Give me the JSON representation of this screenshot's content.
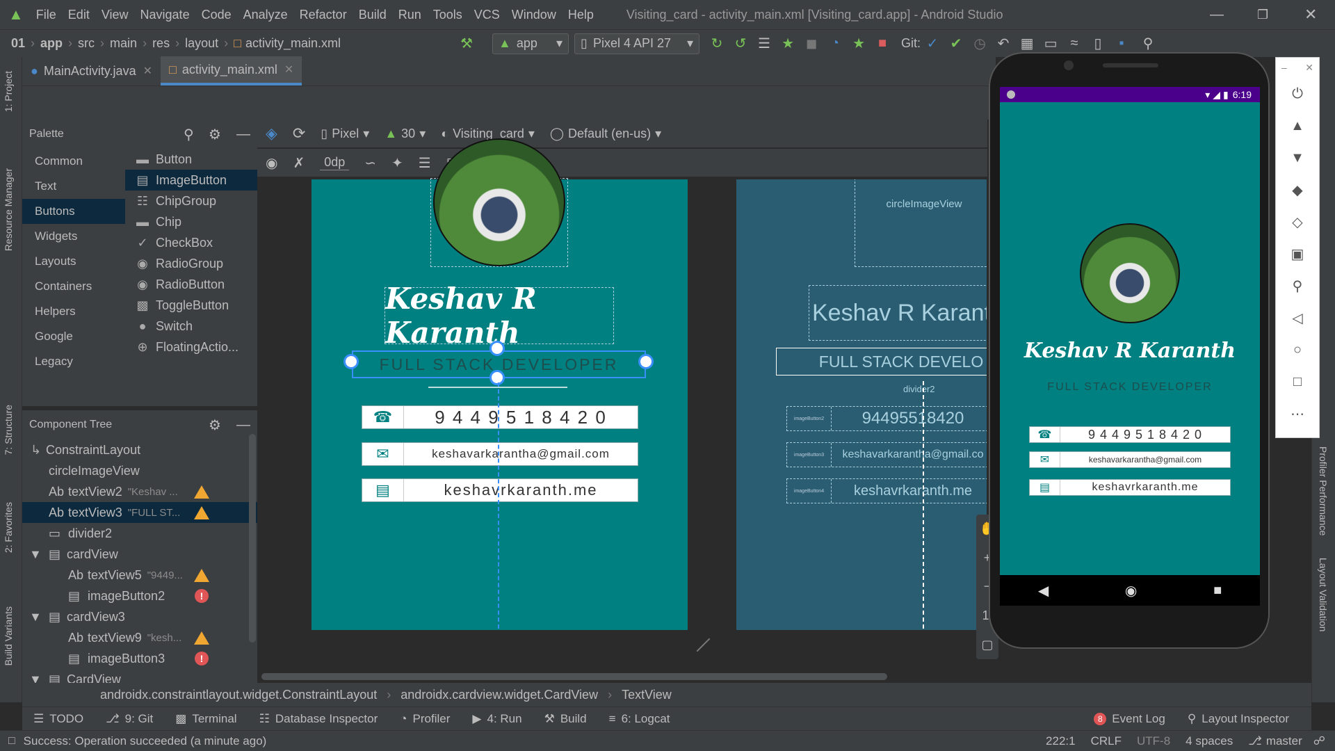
{
  "menubar": {
    "items": [
      "File",
      "Edit",
      "View",
      "Navigate",
      "Code",
      "Analyze",
      "Refactor",
      "Build",
      "Run",
      "Tools",
      "VCS",
      "Window",
      "Help"
    ],
    "title": "Visiting_card - activity_main.xml [Visiting_card.app] - Android Studio"
  },
  "navbar": {
    "crumbs": [
      "01",
      "app",
      "src",
      "main",
      "res",
      "layout",
      "activity_main.xml"
    ],
    "run_config": "app",
    "device": "Pixel 4 API 27",
    "git_label": "Git:"
  },
  "tabs": [
    {
      "label": "MainActivity.java"
    },
    {
      "label": "activity_main.xml"
    }
  ],
  "left_tool": {
    "project": "1: Project",
    "resource_manager": "Resource Manager",
    "structure": "7: Structure",
    "favorites": "2: Favorites",
    "build_variants": "Build Variants"
  },
  "right_tool": {
    "performance": "Profiler Performance",
    "layout_validation": "Layout Validation"
  },
  "palette": {
    "title": "Palette",
    "categories": [
      "Common",
      "Text",
      "Buttons",
      "Widgets",
      "Layouts",
      "Containers",
      "Helpers",
      "Google",
      "Legacy"
    ],
    "selected_category": "Buttons",
    "items": [
      "Button",
      "ImageButton",
      "ChipGroup",
      "Chip",
      "CheckBox",
      "RadioGroup",
      "RadioButton",
      "ToggleButton",
      "Switch",
      "FloatingActio..."
    ]
  },
  "designer_toolbar": {
    "device": "Pixel",
    "api": "30",
    "theme": "Visiting_card",
    "locale": "Default (en-us)",
    "margin": "0dp"
  },
  "component_tree": {
    "title": "Component Tree",
    "rows": [
      {
        "label": "ConstraintLayout",
        "hint": "",
        "status": ""
      },
      {
        "label": "circleImageView",
        "hint": "",
        "status": ""
      },
      {
        "label": "textView2",
        "hint": "\"Keshav ...",
        "status": "warning"
      },
      {
        "label": "textView3",
        "hint": "\"FULL ST...",
        "status": "warning"
      },
      {
        "label": "divider2",
        "hint": "",
        "status": ""
      },
      {
        "label": "cardView",
        "hint": "",
        "status": ""
      },
      {
        "label": "textView5",
        "hint": "\"9449...",
        "status": "warning"
      },
      {
        "label": "imageButton2",
        "hint": "",
        "status": "error"
      },
      {
        "label": "cardView3",
        "hint": "",
        "status": ""
      },
      {
        "label": "textView9",
        "hint": "\"kesh...",
        "status": "warning"
      },
      {
        "label": "imageButton3",
        "hint": "",
        "status": "error"
      },
      {
        "label": "CardView",
        "hint": "",
        "status": ""
      }
    ]
  },
  "card": {
    "name": "Keshav R Karanth",
    "title": "FULL STACK DEVELOPER",
    "phone": "9 4 4 9 5 1 8 4 2 0",
    "email": "keshavarkarantha@gmail.com",
    "website": "keshavrkaranth.me"
  },
  "blueprint": {
    "image_label": "circleImageView",
    "name": "Keshav R Karant",
    "title": "FULL STACK DEVELO",
    "divider": "divider2",
    "phone": "94495518420",
    "email": "keshavarkarantha@gmail.co",
    "website": "keshavrkaranth.me",
    "button_label_2": "imageButton2",
    "button_label_3": "imageButton3",
    "button_label_4": "imageButton4"
  },
  "emulator": {
    "time": "6:19",
    "name": "Keshav R Karanth",
    "title": "FULL STACK DEVELOPER",
    "phone": "9 4 4 9 5 1 8 4 2 0",
    "email": "keshavarkarantha@gmail.com",
    "website": "keshavrkaranth.me"
  },
  "breadcrumb_bottom": [
    "androidx.constraintlayout.widget.ConstraintLayout",
    "androidx.cardview.widget.CardView",
    "TextView"
  ],
  "bottom_tools": {
    "todo": "TODO",
    "git": "9: Git",
    "terminal": "Terminal",
    "database": "Database Inspector",
    "profiler": "Profiler",
    "run": "4: Run",
    "build": "Build",
    "logcat": "6: Logcat",
    "event_log": "Event Log",
    "event_count": "8",
    "layout_inspector": "Layout Inspector"
  },
  "status": {
    "message": "Success: Operation succeeded (a minute ago)",
    "position": "222:1",
    "line_sep": "CRLF",
    "encoding": "UTF-8",
    "indent": "4 spaces",
    "branch": "master"
  },
  "colors": {
    "teal": "#008080",
    "blueprint": "#2a5d71",
    "accent": "#4a88c7"
  }
}
